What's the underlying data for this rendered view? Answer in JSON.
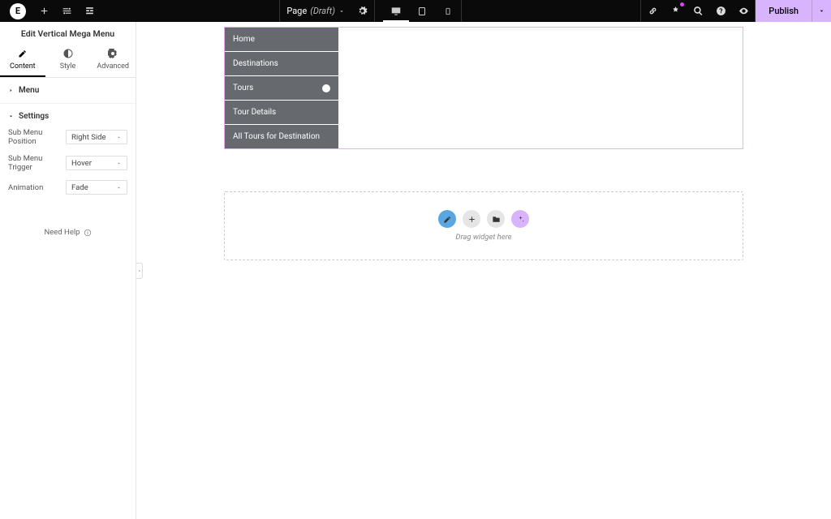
{
  "topbar": {
    "logo_letter": "E",
    "page_label": "Page",
    "page_status": "(Draft)",
    "publish": "Publish"
  },
  "sidebar": {
    "title": "Edit Vertical Mega Menu",
    "tabs": {
      "content": "Content",
      "style": "Style",
      "advanced": "Advanced"
    },
    "section_menu": "Menu",
    "section_settings": "Settings",
    "settings": {
      "position_label": "Sub Menu Position",
      "position_value": "Right Side",
      "trigger_label": "Sub Menu Trigger",
      "trigger_value": "Hover",
      "animation_label": "Animation",
      "animation_value": "Fade"
    },
    "help": "Need Help"
  },
  "canvas": {
    "menu_items": [
      {
        "label": "Home"
      },
      {
        "label": "Destinations"
      },
      {
        "label": "Tours",
        "has_badge": true
      },
      {
        "label": "Tour Details"
      },
      {
        "label": "All Tours for Destination"
      }
    ],
    "dropzone_text": "Drag widget here"
  }
}
